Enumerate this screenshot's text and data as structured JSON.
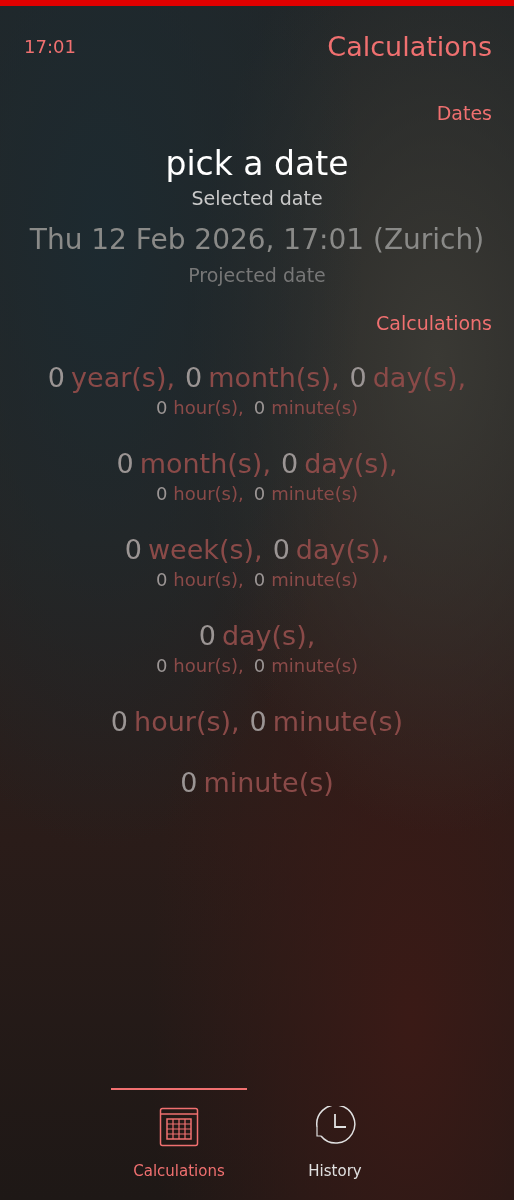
{
  "status_bar": {
    "time": "17:01"
  },
  "page": {
    "title": "Calculations"
  },
  "dates_section": {
    "header": "Dates",
    "picker": {
      "value": "pick a date",
      "label": "Selected date"
    },
    "projected": {
      "value": "Thu 12 Feb 2026, 17:01 (Zurich)",
      "label": "Projected date"
    }
  },
  "calculations_section": {
    "header": "Calculations",
    "results": [
      {
        "main": [
          {
            "value": "0",
            "unit": "year(s),"
          },
          {
            "value": "0",
            "unit": "month(s),"
          },
          {
            "value": "0",
            "unit": "day(s),"
          }
        ],
        "sub": [
          {
            "value": "0",
            "unit": "hour(s),"
          },
          {
            "value": "0",
            "unit": "minute(s)"
          }
        ]
      },
      {
        "main": [
          {
            "value": "0",
            "unit": "month(s),"
          },
          {
            "value": "0",
            "unit": "day(s),"
          }
        ],
        "sub": [
          {
            "value": "0",
            "unit": "hour(s),"
          },
          {
            "value": "0",
            "unit": "minute(s)"
          }
        ]
      },
      {
        "main": [
          {
            "value": "0",
            "unit": "week(s),"
          },
          {
            "value": "0",
            "unit": "day(s),"
          }
        ],
        "sub": [
          {
            "value": "0",
            "unit": "hour(s),"
          },
          {
            "value": "0",
            "unit": "minute(s)"
          }
        ]
      },
      {
        "main": [
          {
            "value": "0",
            "unit": "day(s),"
          }
        ],
        "sub": [
          {
            "value": "0",
            "unit": "hour(s),"
          },
          {
            "value": "0",
            "unit": "minute(s)"
          }
        ]
      },
      {
        "main": [
          {
            "value": "0",
            "unit": "hour(s),"
          },
          {
            "value": "0",
            "unit": "minute(s)"
          }
        ]
      },
      {
        "main": [
          {
            "value": "0",
            "unit": "minute(s)"
          }
        ]
      }
    ]
  },
  "tabs": [
    {
      "label": "Calculations",
      "kind": "calendar",
      "selected": true
    },
    {
      "label": "History",
      "kind": "clock",
      "selected": false
    }
  ]
}
